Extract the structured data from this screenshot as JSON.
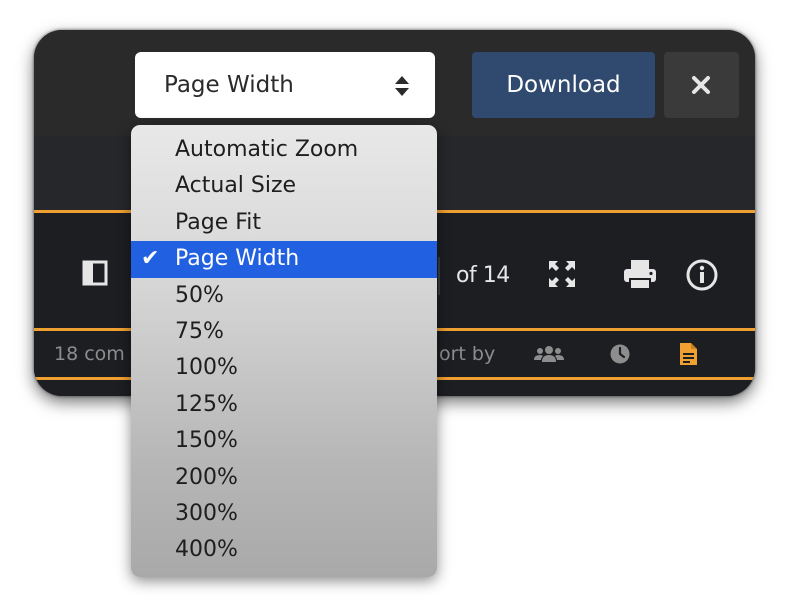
{
  "toolbar": {
    "zoom_value": "Page Width",
    "download_label": "Download",
    "close_icon": "close-icon",
    "accent_color": "#f0a030",
    "download_color": "#2f4a6e"
  },
  "viewer": {
    "page_of": "of 14",
    "icons": [
      "sidebar-toggle-icon",
      "fullscreen-icon",
      "print-icon",
      "info-icon"
    ]
  },
  "info_bar": {
    "comments_text": "18 com",
    "sort_label": "ort by",
    "icons": [
      "people-icon",
      "clock-icon",
      "document-icon"
    ]
  },
  "zoom_menu": {
    "selected_index": 3,
    "selected_color": "#2160e0",
    "options": [
      "Automatic Zoom",
      "Actual Size",
      "Page Fit",
      "Page Width",
      "50%",
      "75%",
      "100%",
      "125%",
      "150%",
      "200%",
      "300%",
      "400%"
    ]
  }
}
